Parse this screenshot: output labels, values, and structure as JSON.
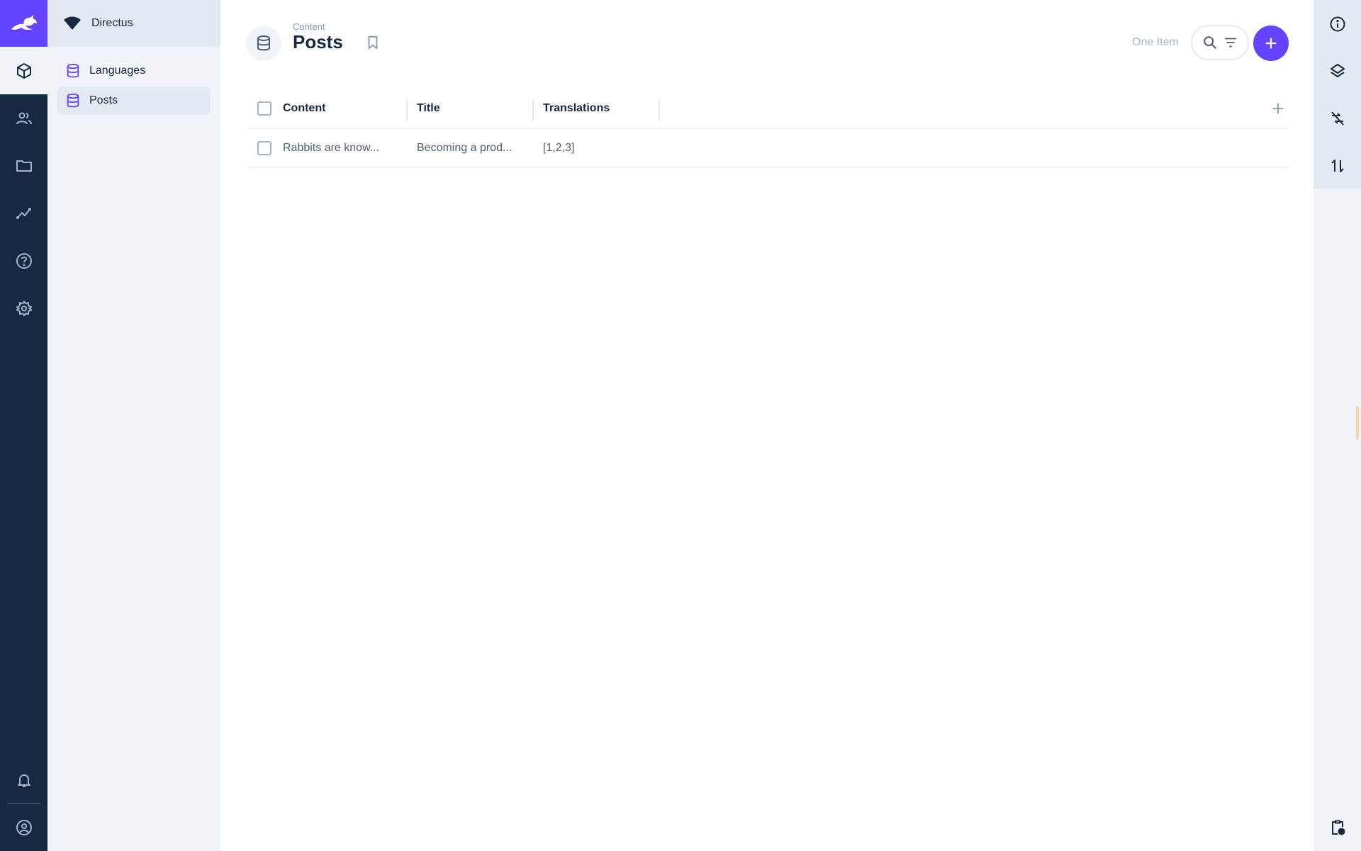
{
  "project": {
    "name": "Directus"
  },
  "navigation": {
    "items": [
      {
        "label": "Languages",
        "active": false
      },
      {
        "label": "Posts",
        "active": true
      }
    ]
  },
  "header": {
    "breadcrumb": "Content",
    "title": "Posts",
    "item_count": "One Item"
  },
  "table": {
    "columns": [
      "Content",
      "Title",
      "Translations"
    ],
    "rows": [
      {
        "content": "Rabbits are know...",
        "title": "Becoming a prod...",
        "translations": "[1,2,3]"
      }
    ]
  },
  "colors": {
    "accent": "#6644ff",
    "module_bar": "#172940",
    "nav_bg": "#f0f4f9"
  },
  "module_bar": {
    "icons": [
      "content-icon",
      "users-icon",
      "files-icon",
      "insights-icon",
      "help-icon",
      "settings-icon",
      "notifications-icon",
      "account-icon"
    ]
  },
  "sidebar": {
    "icons": [
      "info-icon",
      "layout-icon",
      "sync-off-icon",
      "import-export-icon",
      "activity-icon"
    ]
  }
}
